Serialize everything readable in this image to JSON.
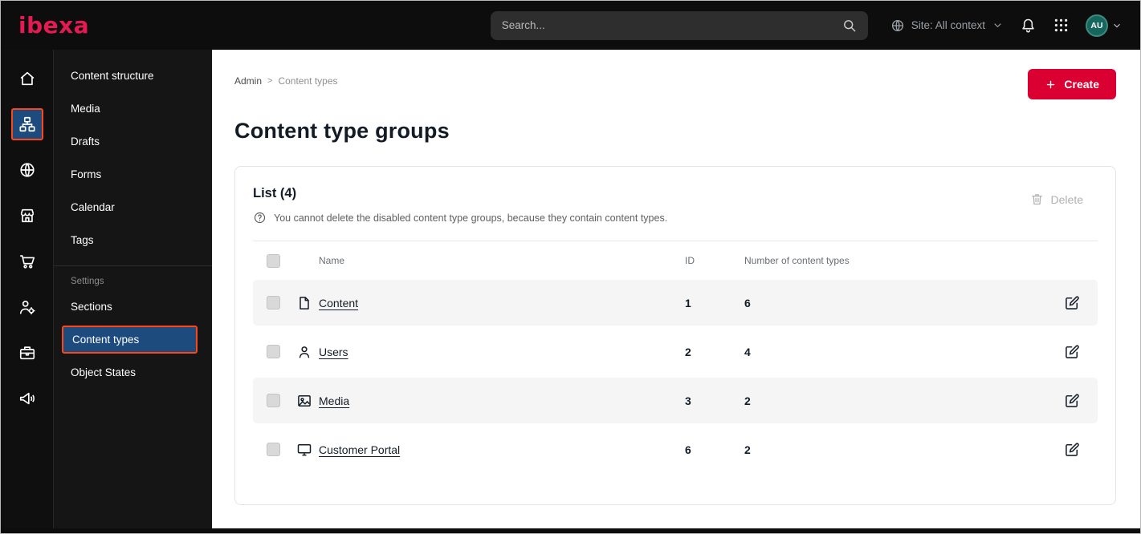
{
  "colors": {
    "topbar_bg": "#0d0d0d",
    "brand_pink": "#e61a53",
    "accent_orange": "#ff4713",
    "active_blue": "#1e4b7d",
    "primary_red": "#db0032",
    "text_dark": "#131c26",
    "row_alt_bg": "#f5f5f5"
  },
  "topbar": {
    "logo_text": "ibexa",
    "search_placeholder": "Search...",
    "site_context_label": "Site: All context",
    "avatar_initials": "AU"
  },
  "icon_rail": {
    "icons": [
      "home",
      "content-structure",
      "site",
      "store",
      "cart",
      "customers",
      "catalog",
      "marketing"
    ],
    "active_icon": "content-structure"
  },
  "sidebar": {
    "items": [
      {
        "label": "Content structure"
      },
      {
        "label": "Media"
      },
      {
        "label": "Drafts"
      },
      {
        "label": "Forms"
      },
      {
        "label": "Calendar"
      },
      {
        "label": "Tags"
      }
    ],
    "section_label": "Settings",
    "settings_items": [
      {
        "label": "Sections"
      },
      {
        "label": "Content types"
      },
      {
        "label": "Object States"
      }
    ],
    "active_item": "Content types"
  },
  "main": {
    "breadcrumb": {
      "root": "Admin",
      "separator": ">",
      "current": "Content types"
    },
    "create_button_label": "Create",
    "page_title": "Content type groups",
    "card": {
      "list_heading": "List (4)",
      "info_text": "You cannot delete the disabled content type groups, because they contain content types.",
      "delete_button_label": "Delete",
      "table": {
        "headers": {
          "name": "Name",
          "id": "ID",
          "count": "Number of content types"
        },
        "rows": [
          {
            "icon": "content-file",
            "name": "Content",
            "id": "1",
            "count": "6"
          },
          {
            "icon": "user",
            "name": "Users",
            "id": "2",
            "count": "4"
          },
          {
            "icon": "media-image",
            "name": "Media",
            "id": "3",
            "count": "2"
          },
          {
            "icon": "customer-portal-monitor",
            "name": "Customer Portal",
            "id": "6",
            "count": "2"
          }
        ]
      }
    }
  }
}
